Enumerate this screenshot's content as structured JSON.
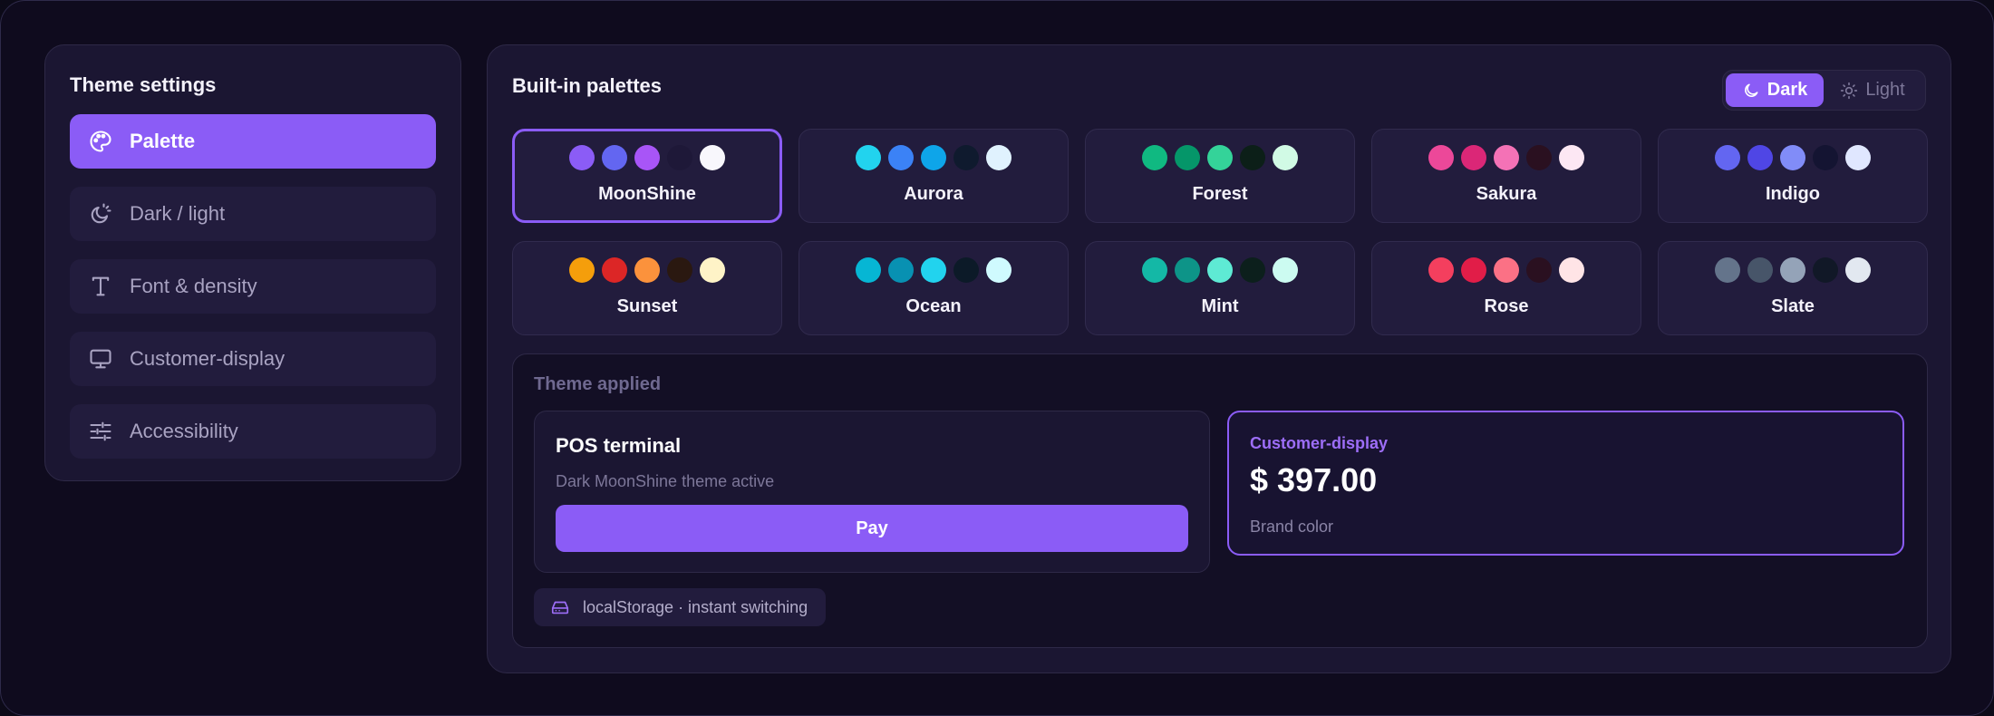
{
  "sidebar": {
    "title": "Theme settings",
    "items": [
      {
        "label": "Palette",
        "icon": "palette-icon",
        "active": true
      },
      {
        "label": "Dark / light",
        "icon": "moon-sun-icon",
        "active": false
      },
      {
        "label": "Font & density",
        "icon": "type-icon",
        "active": false
      },
      {
        "label": "Customer-display",
        "icon": "monitor-icon",
        "active": false
      },
      {
        "label": "Accessibility",
        "icon": "sliders-icon",
        "active": false
      }
    ]
  },
  "main": {
    "title": "Built-in palettes",
    "mode_toggle": {
      "dark_label": "Dark",
      "light_label": "Light",
      "selected": "Dark"
    },
    "palettes": [
      {
        "name": "MoonShine",
        "selected": true,
        "colors": [
          "#8b5cf6",
          "#6366f1",
          "#a855f7",
          "#1e1838",
          "#f8f7fc"
        ]
      },
      {
        "name": "Aurora",
        "selected": false,
        "colors": [
          "#22d3ee",
          "#3b82f6",
          "#0ea5e9",
          "#0f1a2e",
          "#e0f2fe"
        ]
      },
      {
        "name": "Forest",
        "selected": false,
        "colors": [
          "#10b981",
          "#059669",
          "#34d399",
          "#0c1f18",
          "#d1fae5"
        ]
      },
      {
        "name": "Sakura",
        "selected": false,
        "colors": [
          "#ec4899",
          "#db2777",
          "#f472b6",
          "#2a1020",
          "#fce7f3"
        ]
      },
      {
        "name": "Indigo",
        "selected": false,
        "colors": [
          "#6366f1",
          "#4f46e5",
          "#818cf8",
          "#141432",
          "#e0e7ff"
        ]
      },
      {
        "name": "Sunset",
        "selected": false,
        "colors": [
          "#f59e0b",
          "#dc2626",
          "#fb923c",
          "#2a1810",
          "#fef3c7"
        ]
      },
      {
        "name": "Ocean",
        "selected": false,
        "colors": [
          "#06b6d4",
          "#0891b2",
          "#22d3ee",
          "#0c1a28",
          "#cffafe"
        ]
      },
      {
        "name": "Mint",
        "selected": false,
        "colors": [
          "#14b8a6",
          "#0d9488",
          "#5eead4",
          "#0c1f1c",
          "#ccfbf1"
        ]
      },
      {
        "name": "Rose",
        "selected": false,
        "colors": [
          "#f43f5e",
          "#e11d48",
          "#fb7185",
          "#2a1020",
          "#ffe4e6"
        ]
      },
      {
        "name": "Slate",
        "selected": false,
        "colors": [
          "#64748b",
          "#475569",
          "#94a3b8",
          "#111827",
          "#e2e8f0"
        ]
      }
    ],
    "applied": {
      "title": "Theme applied",
      "pos": {
        "title": "POS terminal",
        "subtitle": "Dark MoonShine theme active",
        "pay_label": "Pay"
      },
      "customer_display": {
        "label": "Customer-display",
        "amount": "$ 397.00",
        "subtitle": "Brand color"
      },
      "storage_badge": "localStorage · instant switching"
    }
  },
  "colors": {
    "accent": "#8b5cf6",
    "background": "#0f0b1e",
    "panel": "#1b1632"
  }
}
